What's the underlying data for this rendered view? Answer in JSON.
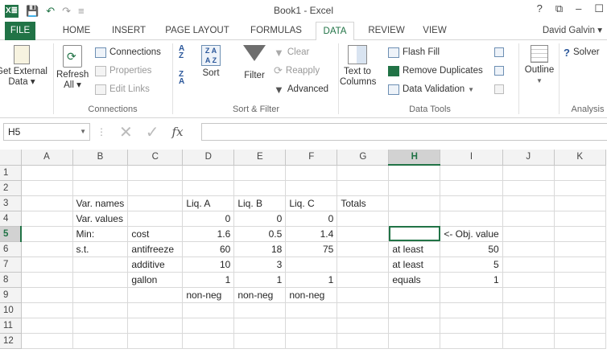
{
  "window": {
    "title": "Book1 - Excel",
    "help": "?",
    "restore": "⧉",
    "minimize": "–",
    "maximize": "☐"
  },
  "qat": {
    "logo": "X≣",
    "save_icon": "save-icon",
    "undo_icon": "undo-icon",
    "redo_icon": "redo-icon",
    "customize_icon": "customize-icon"
  },
  "tabs": [
    {
      "label": "FILE"
    },
    {
      "label": "HOME"
    },
    {
      "label": "INSERT"
    },
    {
      "label": "PAGE LAYOUT"
    },
    {
      "label": "FORMULAS"
    },
    {
      "label": "DATA"
    },
    {
      "label": "REVIEW"
    },
    {
      "label": "VIEW"
    }
  ],
  "active_tab": "DATA",
  "user": "David Galvin ▾",
  "accent": "#217346",
  "ribbon": {
    "get_external": {
      "line1": "Get External",
      "line2": "Data ▾"
    },
    "refresh": {
      "line1": "Refresh",
      "line2": "All ▾"
    },
    "connections": "Connections",
    "properties": "Properties",
    "edit_links": "Edit Links",
    "group_connections": "Connections",
    "sort": "Sort",
    "filter": "Filter",
    "clear": "Clear",
    "reapply": "Reapply",
    "advanced": "Advanced",
    "group_sort": "Sort & Filter",
    "text_to": {
      "line1": "Text to",
      "line2": "Columns"
    },
    "flash_fill": "Flash Fill",
    "remove_duplicates": "Remove Duplicates",
    "data_validation": "Data Validation",
    "group_tools": "Data Tools",
    "outline": "Outline",
    "solver": "Solver",
    "group_analysis": "Analysis"
  },
  "formula_bar": {
    "name_box": "H5",
    "fx": "fx",
    "formula": ""
  },
  "columns": [
    "A",
    "B",
    "C",
    "D",
    "E",
    "F",
    "G",
    "H",
    "I",
    "J",
    "K"
  ],
  "selected_cell": "H5",
  "rows": [
    {
      "n": "1",
      "cells": [
        "",
        "",
        "",
        "",
        "",
        "",
        "",
        "",
        "",
        "",
        ""
      ]
    },
    {
      "n": "2",
      "cells": [
        "",
        "",
        "",
        "",
        "",
        "",
        "",
        "",
        "",
        "",
        ""
      ]
    },
    {
      "n": "3",
      "cells": [
        "",
        "Var. names",
        "",
        "Liq. A",
        "Liq. B",
        "Liq. C",
        "Totals",
        "",
        "",
        "",
        ""
      ]
    },
    {
      "n": "4",
      "cells": [
        "",
        "Var. values",
        "",
        "0",
        "0",
        "0",
        "",
        "",
        "",
        "",
        ""
      ]
    },
    {
      "n": "5",
      "cells": [
        "",
        "Min:",
        "cost",
        "1.6",
        "0.5",
        "1.4",
        "",
        "",
        "<- Obj. value",
        "",
        ""
      ]
    },
    {
      "n": "6",
      "cells": [
        "",
        "s.t.",
        "antifreeze",
        "60",
        "18",
        "75",
        "",
        "at least",
        "50",
        "",
        ""
      ]
    },
    {
      "n": "7",
      "cells": [
        "",
        "",
        "additive",
        "10",
        "3",
        "",
        "",
        "at least",
        "5",
        "",
        ""
      ]
    },
    {
      "n": "8",
      "cells": [
        "",
        "",
        "gallon",
        "1",
        "1",
        "1",
        "",
        "equals",
        "1",
        "",
        ""
      ]
    },
    {
      "n": "9",
      "cells": [
        "",
        "",
        "",
        "non-neg",
        "non-neg",
        "non-neg",
        "",
        "",
        "",
        "",
        ""
      ]
    },
    {
      "n": "10",
      "cells": [
        "",
        "",
        "",
        "",
        "",
        "",
        "",
        "",
        "",
        "",
        ""
      ]
    },
    {
      "n": "11",
      "cells": [
        "",
        "",
        "",
        "",
        "",
        "",
        "",
        "",
        "",
        "",
        ""
      ]
    },
    {
      "n": "12",
      "cells": [
        "",
        "",
        "",
        "",
        "",
        "",
        "",
        "",
        "",
        "",
        ""
      ]
    }
  ]
}
